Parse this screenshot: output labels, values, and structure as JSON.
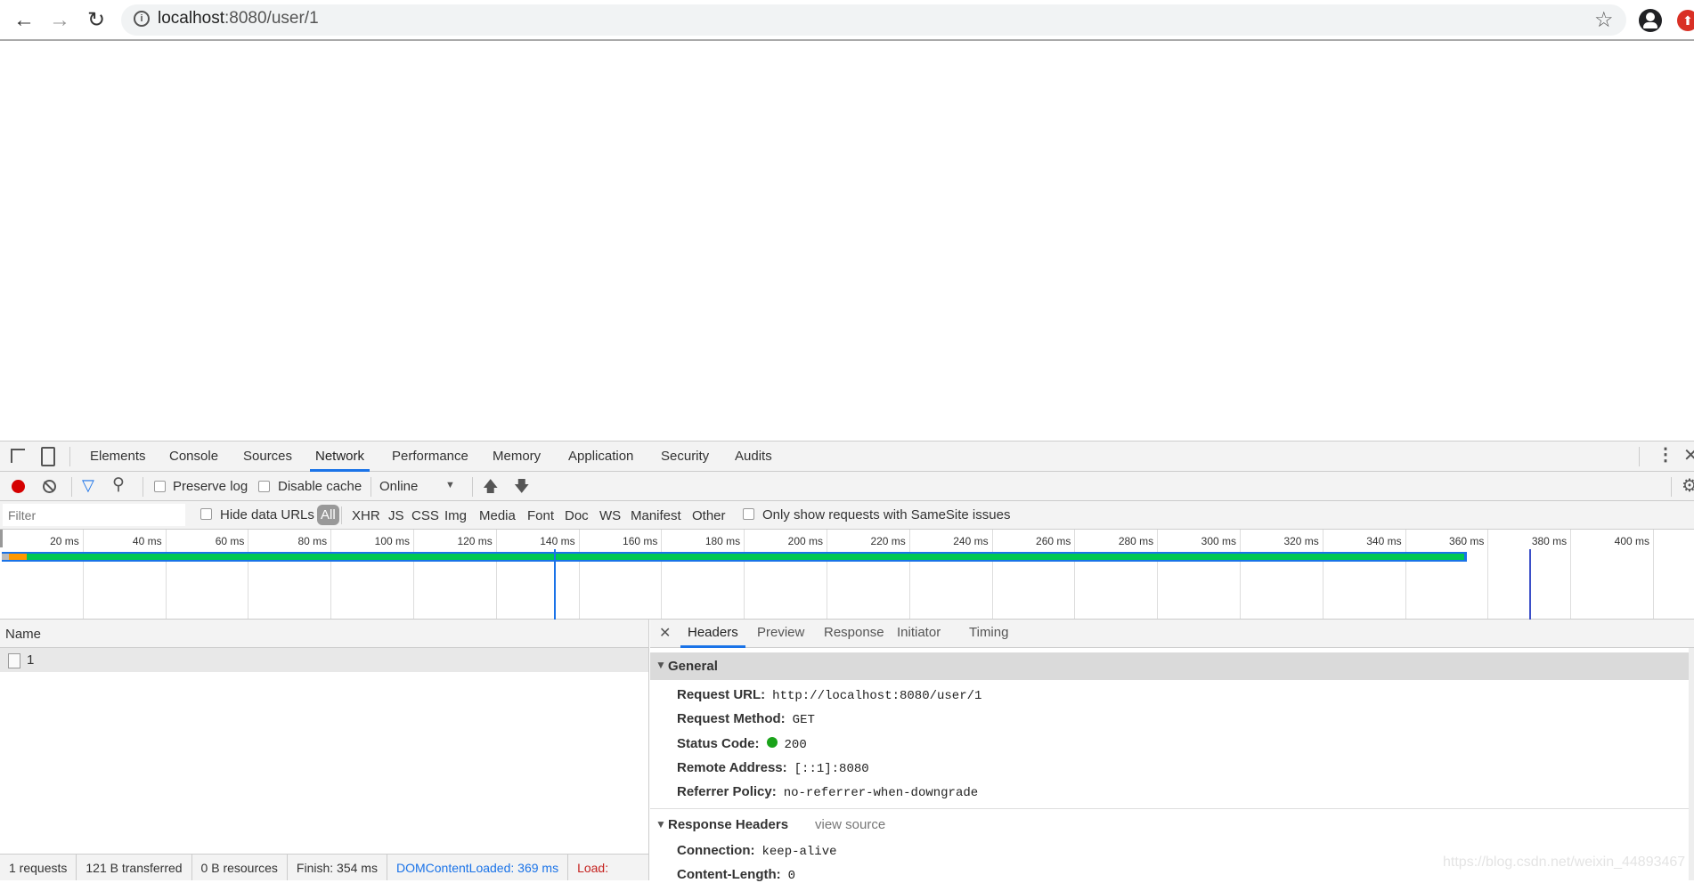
{
  "browser": {
    "url_host": "localhost",
    "url_rest": ":8080/user/1",
    "icons": [
      "back-arrow",
      "forward-arrow",
      "reload",
      "info",
      "star",
      "account",
      "update"
    ]
  },
  "devtools": {
    "tabs": [
      "Elements",
      "Console",
      "Sources",
      "Network",
      "Performance",
      "Memory",
      "Application",
      "Security",
      "Audits"
    ],
    "active_tab": "Network",
    "toolbar": {
      "preserve_log": "Preserve log",
      "disable_cache": "Disable cache",
      "throttle": "Online"
    },
    "filter": {
      "placeholder": "Filter",
      "hide_data_urls": "Hide data URLs",
      "types": [
        "All",
        "XHR",
        "JS",
        "CSS",
        "Img",
        "Media",
        "Font",
        "Doc",
        "WS",
        "Manifest",
        "Other"
      ],
      "active_type": "All",
      "samesite": "Only show requests with SameSite issues"
    },
    "timeline": {
      "ticks": [
        "20 ms",
        "40 ms",
        "60 ms",
        "80 ms",
        "100 ms",
        "120 ms",
        "140 ms",
        "160 ms",
        "180 ms",
        "200 ms",
        "220 ms",
        "240 ms",
        "260 ms",
        "280 ms",
        "300 ms",
        "320 ms",
        "340 ms",
        "360 ms",
        "380 ms",
        "400 ms"
      ],
      "request_end_ms": 355,
      "dom_content_loaded_ms": 134,
      "load_ms": 370,
      "colors": {
        "waiting": "#00c853",
        "download": "#ff9800",
        "dcl": "#1a73e8",
        "load": "#c5221f"
      }
    },
    "requests": {
      "header": "Name",
      "rows": [
        {
          "name": "1"
        }
      ]
    },
    "detail": {
      "tabs": [
        "Headers",
        "Preview",
        "Response",
        "Initiator",
        "Timing"
      ],
      "active": "Headers",
      "general_title": "General",
      "general": [
        {
          "k": "Request URL:",
          "v": "http://localhost:8080/user/1"
        },
        {
          "k": "Request Method:",
          "v": "GET"
        },
        {
          "k": "Status Code:",
          "v": "200",
          "status_color": "#1aa31a"
        },
        {
          "k": "Remote Address:",
          "v": "[::1]:8080"
        },
        {
          "k": "Referrer Policy:",
          "v": "no-referrer-when-downgrade"
        }
      ],
      "response_title": "Response Headers",
      "view_source": "view source",
      "response": [
        {
          "k": "Connection:",
          "v": "keep-alive"
        },
        {
          "k": "Content-Length:",
          "v": "0"
        }
      ]
    },
    "status": {
      "requests": "1 requests",
      "transferred": "121 B transferred",
      "resources": "0 B resources",
      "finish": "Finish: 354 ms",
      "dcl": "DOMContentLoaded: 369 ms",
      "load": "Load:"
    }
  },
  "watermark": "https://blog.csdn.net/weixin_44893467"
}
